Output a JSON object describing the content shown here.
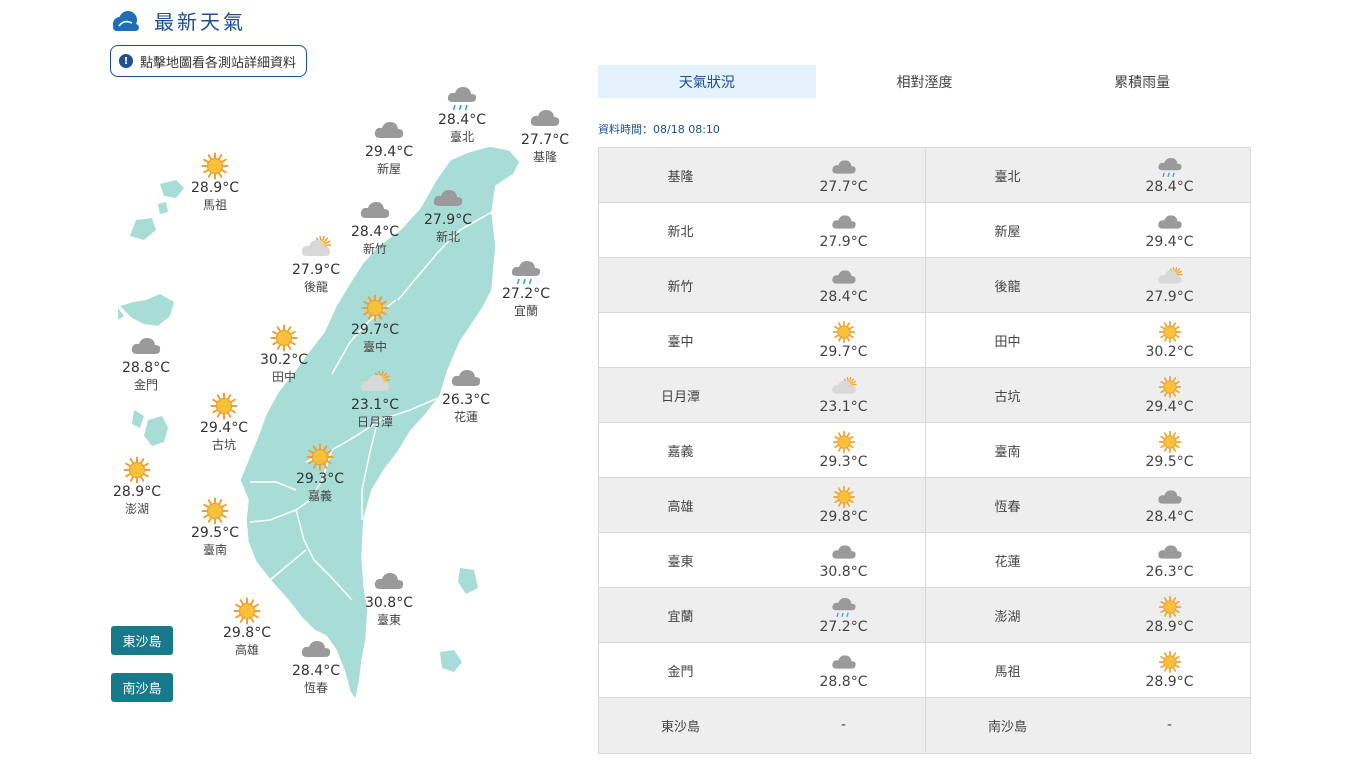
{
  "header": {
    "title": "最新天氣",
    "logo_icon": "cloud-icon"
  },
  "hint": {
    "label": "點擊地圖看各測站詳細資料",
    "icon": "info-icon"
  },
  "map": {
    "land_color": "#a8ddd7",
    "stations": [
      {
        "key": "keelung",
        "name": "基隆",
        "temp": "27.7°C",
        "weather": "cloudy"
      },
      {
        "key": "taipei",
        "name": "臺北",
        "temp": "28.4°C",
        "weather": "rain"
      },
      {
        "key": "xinwu",
        "name": "新屋",
        "temp": "29.4°C",
        "weather": "cloudy"
      },
      {
        "key": "newtaipei",
        "name": "新北",
        "temp": "27.9°C",
        "weather": "cloudy"
      },
      {
        "key": "hsinchu",
        "name": "新竹",
        "temp": "28.4°C",
        "weather": "cloudy"
      },
      {
        "key": "houlong",
        "name": "後龍",
        "temp": "27.9°C",
        "weather": "partly"
      },
      {
        "key": "yilan",
        "name": "宜蘭",
        "temp": "27.2°C",
        "weather": "rain"
      },
      {
        "key": "matsu",
        "name": "馬祖",
        "temp": "28.9°C",
        "weather": "sunny"
      },
      {
        "key": "taichung",
        "name": "臺中",
        "temp": "29.7°C",
        "weather": "sunny"
      },
      {
        "key": "tianzhong",
        "name": "田中",
        "temp": "30.2°C",
        "weather": "sunny"
      },
      {
        "key": "kinmen",
        "name": "金門",
        "temp": "28.8°C",
        "weather": "cloudy"
      },
      {
        "key": "sunmoonlake",
        "name": "日月潭",
        "temp": "23.1°C",
        "weather": "partly"
      },
      {
        "key": "hualien",
        "name": "花蓮",
        "temp": "26.3°C",
        "weather": "cloudy"
      },
      {
        "key": "gukeng",
        "name": "古坑",
        "temp": "29.4°C",
        "weather": "sunny"
      },
      {
        "key": "penghu",
        "name": "澎湖",
        "temp": "28.9°C",
        "weather": "sunny"
      },
      {
        "key": "chiayi",
        "name": "嘉義",
        "temp": "29.3°C",
        "weather": "sunny"
      },
      {
        "key": "tainan",
        "name": "臺南",
        "temp": "29.5°C",
        "weather": "sunny"
      },
      {
        "key": "taitung",
        "name": "臺東",
        "temp": "30.8°C",
        "weather": "cloudy"
      },
      {
        "key": "kaohsiung",
        "name": "高雄",
        "temp": "29.8°C",
        "weather": "sunny"
      },
      {
        "key": "hengchun",
        "name": "恆春",
        "temp": "28.4°C",
        "weather": "cloudy"
      }
    ],
    "island_buttons": [
      "東沙島",
      "南沙島"
    ]
  },
  "tabs": [
    "天氣狀況",
    "相對溼度",
    "累積雨量"
  ],
  "data_time": "資料時間：08/18 08:10",
  "table": [
    [
      {
        "name": "基隆",
        "temp": "27.7°C",
        "weather": "cloudy"
      },
      {
        "name": "臺北",
        "temp": "28.4°C",
        "weather": "rain"
      }
    ],
    [
      {
        "name": "新北",
        "temp": "27.9°C",
        "weather": "cloudy"
      },
      {
        "name": "新屋",
        "temp": "29.4°C",
        "weather": "cloudy"
      }
    ],
    [
      {
        "name": "新竹",
        "temp": "28.4°C",
        "weather": "cloudy"
      },
      {
        "name": "後龍",
        "temp": "27.9°C",
        "weather": "partly"
      }
    ],
    [
      {
        "name": "臺中",
        "temp": "29.7°C",
        "weather": "sunny"
      },
      {
        "name": "田中",
        "temp": "30.2°C",
        "weather": "sunny"
      }
    ],
    [
      {
        "name": "日月潭",
        "temp": "23.1°C",
        "weather": "partly"
      },
      {
        "name": "古坑",
        "temp": "29.4°C",
        "weather": "sunny"
      }
    ],
    [
      {
        "name": "嘉義",
        "temp": "29.3°C",
        "weather": "sunny"
      },
      {
        "name": "臺南",
        "temp": "29.5°C",
        "weather": "sunny"
      }
    ],
    [
      {
        "name": "高雄",
        "temp": "29.8°C",
        "weather": "sunny"
      },
      {
        "name": "恆春",
        "temp": "28.4°C",
        "weather": "cloudy"
      }
    ],
    [
      {
        "name": "臺東",
        "temp": "30.8°C",
        "weather": "cloudy"
      },
      {
        "name": "花蓮",
        "temp": "26.3°C",
        "weather": "cloudy"
      }
    ],
    [
      {
        "name": "宜蘭",
        "temp": "27.2°C",
        "weather": "rain"
      },
      {
        "name": "澎湖",
        "temp": "28.9°C",
        "weather": "sunny"
      }
    ],
    [
      {
        "name": "金門",
        "temp": "28.8°C",
        "weather": "cloudy"
      },
      {
        "name": "馬祖",
        "temp": "28.9°C",
        "weather": "sunny"
      }
    ],
    [
      {
        "name": "東沙島",
        "temp": "-",
        "weather": ""
      },
      {
        "name": "南沙島",
        "temp": "-",
        "weather": ""
      }
    ]
  ]
}
